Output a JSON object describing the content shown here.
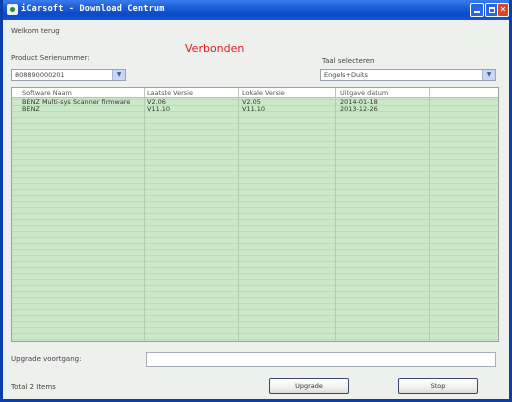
{
  "window": {
    "title": "iCarsoft - Download Centrum"
  },
  "greeting": "Welkom terug",
  "status": "Verbonden",
  "serial": {
    "label": "Product Serienummer:",
    "value": "808890000201"
  },
  "language": {
    "label": "Taal selecteren",
    "value": "Engels+Duits"
  },
  "table": {
    "columns": [
      "Software Naam",
      "Laatste Versie",
      "Lokale Versie",
      "Uitgave datum"
    ],
    "rows": [
      [
        "BENZ Multi-sys Scanner firmware",
        "V2.06",
        "V2.05",
        "2014-01-18"
      ],
      [
        "BENZ",
        "V11.10",
        "V11.10",
        "2013-12-26"
      ]
    ]
  },
  "upgrade_progress": {
    "label": "Upgrade voortgang:",
    "value": 0
  },
  "footer": {
    "total": "Total 2 Items",
    "upgrade_button": "Upgrade",
    "stop_button": "Stop"
  }
}
